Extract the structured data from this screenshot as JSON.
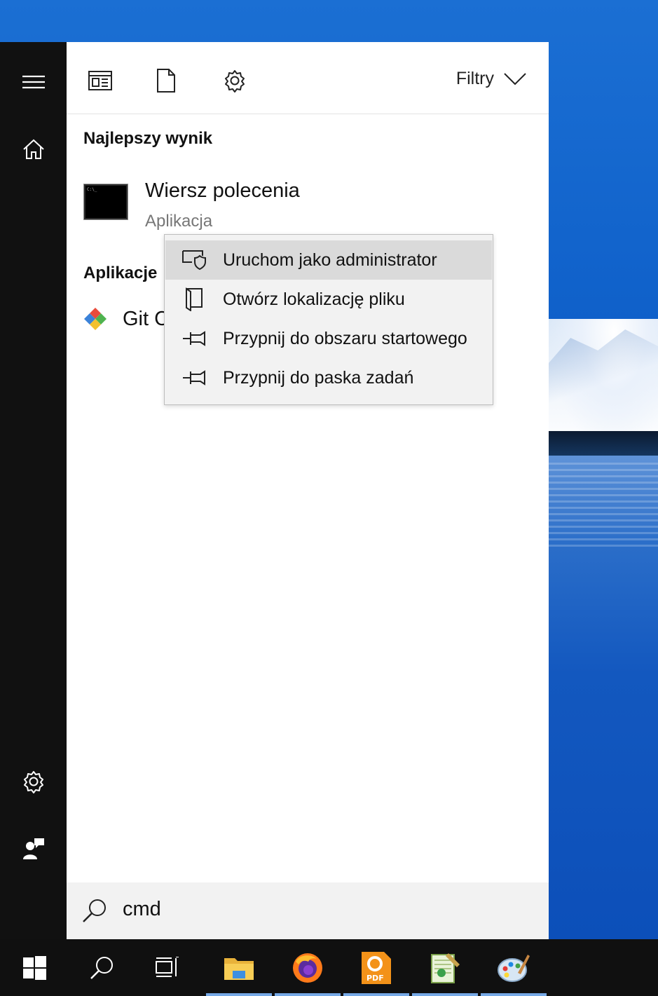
{
  "start_menu": {
    "rail": {
      "menu_icon": "hamburger-icon",
      "home_icon": "home-icon",
      "settings_icon": "gear-icon",
      "feedback_icon": "feedback-icon"
    },
    "toolbar": {
      "icons": [
        "apps-filter-icon",
        "documents-filter-icon",
        "settings-filter-icon"
      ],
      "filters_label": "Filtry"
    },
    "best_match": {
      "heading": "Najlepszy wynik",
      "title": "Wiersz polecenia",
      "subtitle": "Aplikacja"
    },
    "apps": {
      "heading": "Aplikacje",
      "items": [
        {
          "label": "Git C"
        }
      ]
    },
    "search": {
      "value": "cmd"
    }
  },
  "context_menu": {
    "items": [
      {
        "label": "Uruchom jako administrator",
        "icon": "shield-icon",
        "highlighted": true
      },
      {
        "label": "Otwórz lokalizację pliku",
        "icon": "folder-icon"
      },
      {
        "label": "Przypnij do obszaru startowego",
        "icon": "pin-icon"
      },
      {
        "label": "Przypnij do paska zadań",
        "icon": "pin-icon"
      }
    ]
  },
  "taskbar": {
    "items": [
      "windows-start-icon",
      "search-icon",
      "task-view-icon",
      "file-explorer-icon",
      "firefox-icon",
      "pdf-app-icon",
      "notepad-app-icon",
      "paint-app-icon"
    ]
  },
  "colors": {
    "accent": "#76a9e6",
    "rail": "#111111",
    "taskbar": "#101010",
    "highlight": "#dadada"
  }
}
